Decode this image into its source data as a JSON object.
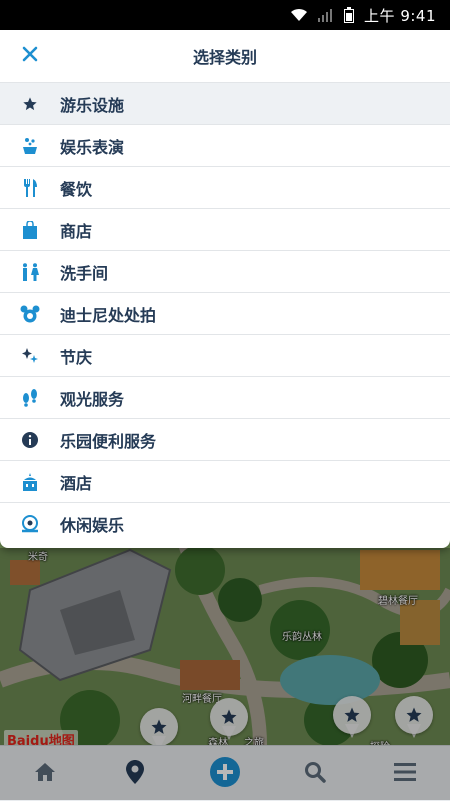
{
  "status_bar": {
    "time": "上午 9:41"
  },
  "header": {
    "title": "选择类别"
  },
  "categories": [
    {
      "label": "游乐设施",
      "icon": "star-icon",
      "selected": true
    },
    {
      "label": "娱乐表演",
      "icon": "show-icon",
      "selected": false
    },
    {
      "label": "餐饮",
      "icon": "dining-icon",
      "selected": false
    },
    {
      "label": "商店",
      "icon": "shopping-bag-icon",
      "selected": false
    },
    {
      "label": "洗手间",
      "icon": "restroom-icon",
      "selected": false
    },
    {
      "label": "迪士尼处处拍",
      "icon": "photo-icon",
      "selected": false
    },
    {
      "label": "节庆",
      "icon": "sparkle-icon",
      "selected": false
    },
    {
      "label": "观光服务",
      "icon": "footprints-icon",
      "selected": false
    },
    {
      "label": "乐园便利服务",
      "icon": "info-icon",
      "selected": false
    },
    {
      "label": "酒店",
      "icon": "hotel-icon",
      "selected": false
    },
    {
      "label": "休闲娱乐",
      "icon": "recreation-icon",
      "selected": false
    }
  ],
  "map": {
    "labels": [
      "米奇",
      "碧林餐厅",
      "乐韵丛林",
      "河畔餐厅",
      "森林",
      "之旅",
      "探险",
      "Bai",
      "du",
      "地图"
    ]
  },
  "bottom_nav": [
    "home-icon",
    "location-icon",
    "add-icon",
    "search-icon",
    "menu-icon"
  ],
  "colors": {
    "accent": "#1d8fd0",
    "text": "#253b56",
    "nav_bg": "#e9ecef"
  }
}
